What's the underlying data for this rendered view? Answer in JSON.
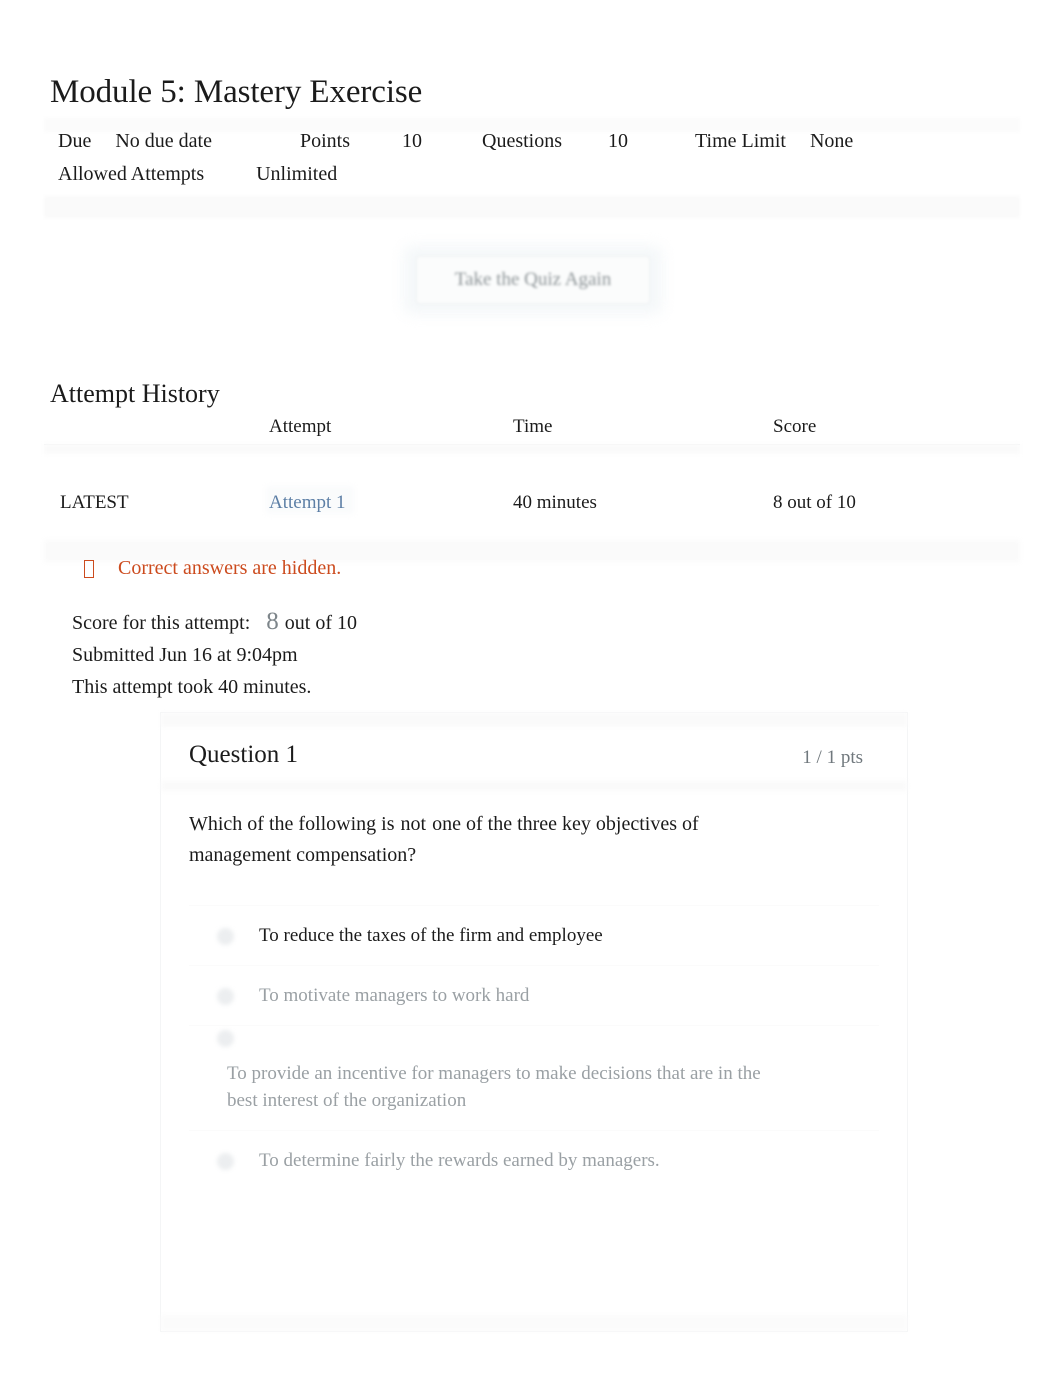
{
  "page": {
    "title": "Module 5: Mastery Exercise"
  },
  "meta": {
    "due_label": "Due",
    "due_value": "No due date",
    "points_label": "Points",
    "points_value": "10",
    "questions_label": "Questions",
    "questions_value": "10",
    "time_limit_label": "Time Limit",
    "time_limit_value": "None",
    "attempts_label": "Allowed Attempts",
    "attempts_value": "Unlimited"
  },
  "actions": {
    "retake_label": "Take the Quiz Again"
  },
  "attempt_history": {
    "heading": "Attempt History",
    "columns": [
      "",
      "Attempt",
      "Time",
      "Score"
    ],
    "rows": [
      {
        "kept": "LATEST",
        "attempt": "Attempt 1",
        "time": "40 minutes",
        "score": "8 out of 10"
      }
    ]
  },
  "notice": {
    "icon": "warning-icon",
    "text": "Correct answers are hidden."
  },
  "summary": {
    "score_prefix": "Score for this attempt:",
    "score_value": "8",
    "score_suffix": "out of 10",
    "submitted": "Submitted Jun 16 at 9:04pm",
    "duration": "This attempt took 40 minutes."
  },
  "question": {
    "name": "Question 1",
    "points": "1 / 1 pts",
    "text_before": "Which of the following is",
    "text_emphasis": "not",
    "text_after": "one of the three key objectives of management compensation?",
    "answers": [
      {
        "text": "To reduce the taxes of the firm and employee",
        "selected": true,
        "wrapping": false
      },
      {
        "text": "To motivate managers to work hard",
        "selected": false,
        "wrapping": false
      },
      {
        "text": "To provide an incentive for managers to make decisions that are in the best interest of the organization",
        "selected": false,
        "wrapping": true
      },
      {
        "text": "To determine fairly the rewards earned by managers.",
        "selected": false,
        "wrapping": false
      }
    ]
  },
  "colors": {
    "warning": "#cc4b1e",
    "link": "#5d7fa6",
    "text": "#1b1b1b",
    "muted": "#9aa0a4"
  }
}
